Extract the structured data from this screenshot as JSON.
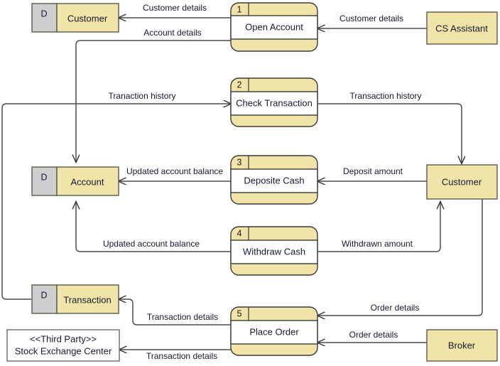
{
  "diagram": {
    "type": "data-flow-diagram",
    "colors": {
      "entity_fill": "#f0e4a8",
      "store_key_fill": "#cfcfcf",
      "process_band_fill": "#ffffff",
      "third_party_fill": "#ffffff",
      "line": "#4d4d4d",
      "text": "#181830"
    },
    "data_stores": [
      {
        "id": "ds-customer",
        "key": "D",
        "label": "Customer"
      },
      {
        "id": "ds-account",
        "key": "D",
        "label": "Account"
      },
      {
        "id": "ds-transaction",
        "key": "D",
        "label": "Transaction"
      }
    ],
    "processes": [
      {
        "id": "p1",
        "number": "1",
        "label": "Open Account"
      },
      {
        "id": "p2",
        "number": "2",
        "label": "Check Transaction"
      },
      {
        "id": "p3",
        "number": "3",
        "label": "Deposite Cash"
      },
      {
        "id": "p4",
        "number": "4",
        "label": "Withdraw Cash"
      },
      {
        "id": "p5",
        "number": "5",
        "label": "Place Order"
      }
    ],
    "external_entities": [
      {
        "id": "e-cs-assistant",
        "label": "CS Assistant"
      },
      {
        "id": "e-customer",
        "label": "Customer"
      },
      {
        "id": "e-broker",
        "label": "Broker"
      }
    ],
    "third_party": {
      "id": "e-stock-exchange",
      "stereotype": "<<Third Party>>",
      "label": "Stock Exchange Center"
    },
    "flows": [
      {
        "id": "f1",
        "label": "Customer details",
        "from": "p1",
        "to": "ds-customer"
      },
      {
        "id": "f2",
        "label": "Customer details",
        "from": "e-cs-assistant",
        "to": "p1"
      },
      {
        "id": "f3",
        "label": "Account details",
        "from": "p1",
        "to": "ds-account"
      },
      {
        "id": "f4",
        "label": "Tranaction history",
        "from": "ds-transaction",
        "to": "p2"
      },
      {
        "id": "f5",
        "label": "Transaction history",
        "from": "p2",
        "to": "e-customer"
      },
      {
        "id": "f6",
        "label": "Updated account balance",
        "from": "p3",
        "to": "ds-account"
      },
      {
        "id": "f7",
        "label": "Deposit amount",
        "from": "e-customer",
        "to": "p3"
      },
      {
        "id": "f8",
        "label": "Updated account balance",
        "from": "p4",
        "to": "ds-account"
      },
      {
        "id": "f9",
        "label": "Withdrawn amount",
        "from": "p4",
        "to": "e-customer"
      },
      {
        "id": "f10",
        "label": "Transaction details",
        "from": "p5",
        "to": "ds-transaction"
      },
      {
        "id": "f11",
        "label": "Order details",
        "from": "e-customer",
        "to": "p5"
      },
      {
        "id": "f12",
        "label": "Order details",
        "from": "e-broker",
        "to": "p5"
      },
      {
        "id": "f13",
        "label": "Transaction details",
        "from": "p5",
        "to": "e-stock-exchange"
      }
    ]
  }
}
